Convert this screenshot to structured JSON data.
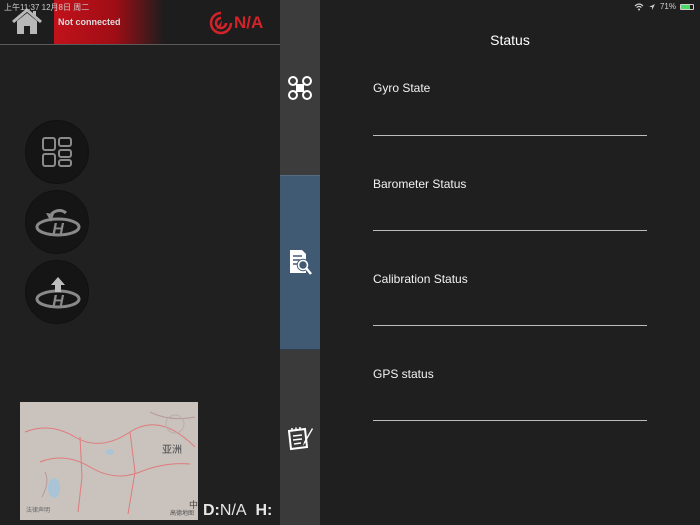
{
  "status_bar": {
    "time": "上午11:37  12月8日 周二",
    "battery": "71%",
    "battery_level": 0.71
  },
  "header": {
    "connection_status": "Not connected",
    "signal_value": "N/A"
  },
  "map": {
    "continent_label": "亚洲",
    "country_label": "中",
    "copyright": "高德地图",
    "logo": "法律声明"
  },
  "telemetry": {
    "distance_label": "D:",
    "distance_value": "N/A",
    "height_label": "H:"
  },
  "status": {
    "title": "Status",
    "fields": [
      {
        "label": "Gyro State",
        "value": ""
      },
      {
        "label": "Barometer Status",
        "value": ""
      },
      {
        "label": "Calibration Status",
        "value": ""
      },
      {
        "label": "GPS status",
        "value": ""
      }
    ]
  },
  "colors": {
    "accent_red": "#c1121b",
    "active_tab": "#405a73",
    "background": "#1f1f1f"
  },
  "icons": [
    "home-icon",
    "signal-icon",
    "grid-icon",
    "return-home-icon",
    "takeoff-icon",
    "drone-icon",
    "document-search-icon",
    "notebook-pen-icon",
    "wifi-icon",
    "location-arrow-icon"
  ]
}
